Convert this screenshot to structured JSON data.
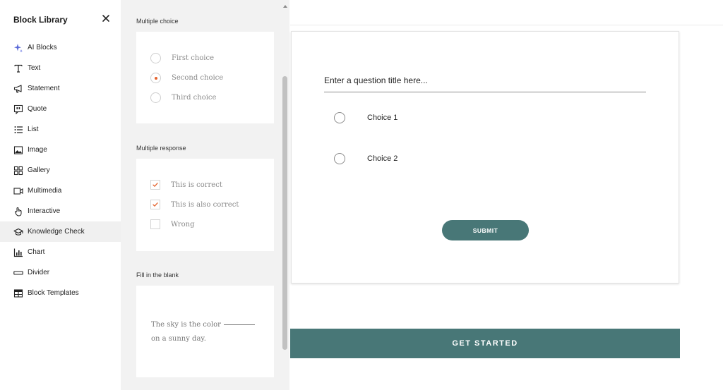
{
  "sidebar": {
    "title": "Block Library",
    "close_icon": "close-icon",
    "items": [
      {
        "label": "AI Blocks",
        "icon": "sparkle-icon"
      },
      {
        "label": "Text",
        "icon": "text-icon"
      },
      {
        "label": "Statement",
        "icon": "megaphone-icon"
      },
      {
        "label": "Quote",
        "icon": "quote-icon"
      },
      {
        "label": "List",
        "icon": "list-icon"
      },
      {
        "label": "Image",
        "icon": "image-icon"
      },
      {
        "label": "Gallery",
        "icon": "gallery-icon"
      },
      {
        "label": "Multimedia",
        "icon": "video-icon"
      },
      {
        "label": "Interactive",
        "icon": "pointer-icon"
      },
      {
        "label": "Knowledge Check",
        "icon": "graduation-cap-icon",
        "active": true
      },
      {
        "label": "Chart",
        "icon": "chart-icon"
      },
      {
        "label": "Divider",
        "icon": "divider-icon"
      },
      {
        "label": "Block Templates",
        "icon": "table-icon"
      }
    ]
  },
  "panel": {
    "multiple_choice": {
      "title": "Multiple choice",
      "choices": [
        "First choice",
        "Second choice",
        "Third choice"
      ],
      "selected_index": 1
    },
    "multiple_response": {
      "title": "Multiple response",
      "options": [
        {
          "label": "This is correct",
          "checked": true
        },
        {
          "label": "This is also correct",
          "checked": true
        },
        {
          "label": "Wrong",
          "checked": false
        }
      ]
    },
    "fill_blank": {
      "title": "Fill in the blank",
      "text_before": "The sky is the color",
      "text_after": "on a sunny day."
    }
  },
  "main": {
    "question_placeholder": "Enter a question title here...",
    "choices": [
      "Choice 1",
      "Choice 2"
    ],
    "submit_label": "SUBMIT",
    "get_started_label": "GET STARTED"
  },
  "colors": {
    "accent": "#487777",
    "radio_selected": "#e4622d",
    "panel_bg": "#f2f2f2"
  }
}
